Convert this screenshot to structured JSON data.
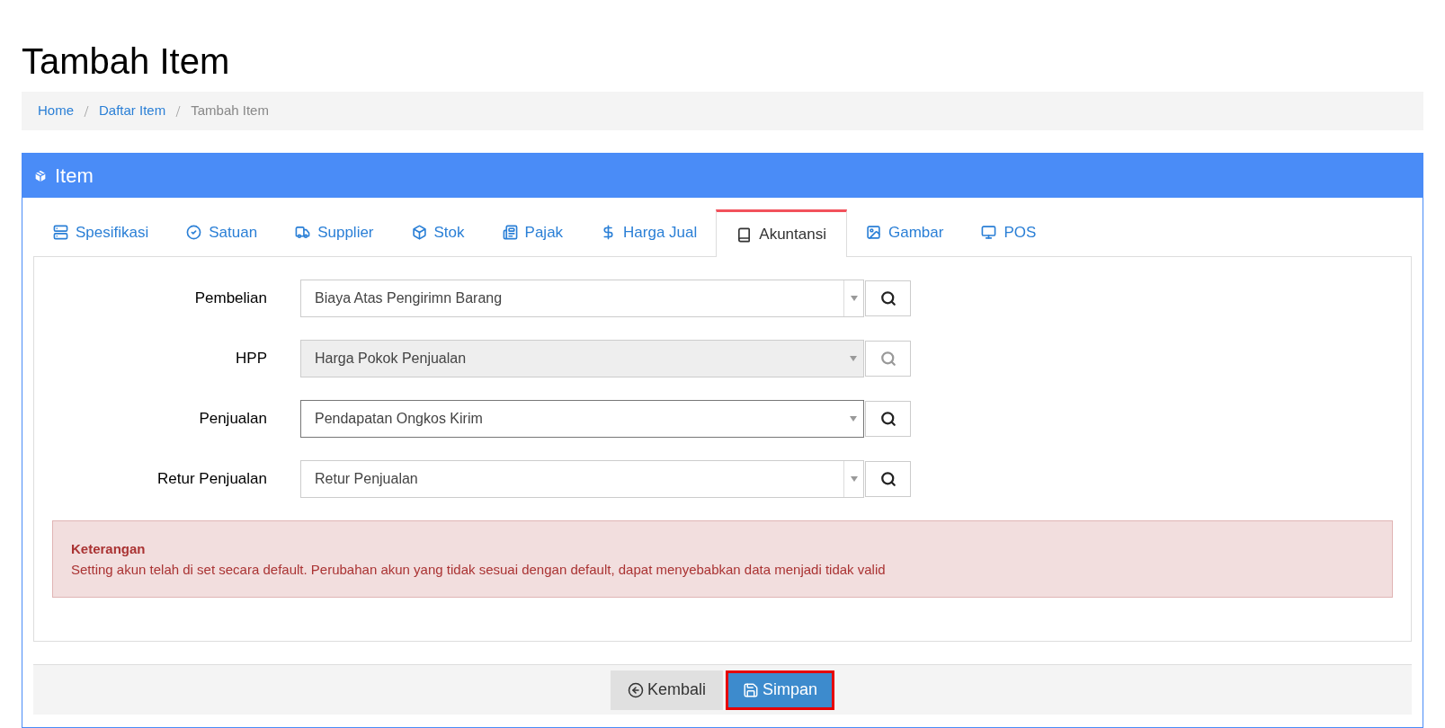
{
  "page_title": "Tambah Item",
  "breadcrumb": [
    {
      "label": "Home",
      "link": true
    },
    {
      "label": "Daftar Item",
      "link": true
    },
    {
      "label": "Tambah Item",
      "link": false
    }
  ],
  "panel": {
    "title": "Item"
  },
  "tabs": [
    {
      "label": "Spesifikasi",
      "kind": "list",
      "selected": false
    },
    {
      "label": "Satuan",
      "kind": "check",
      "selected": false
    },
    {
      "label": "Supplier",
      "kind": "truck",
      "selected": false
    },
    {
      "label": "Stok",
      "kind": "box",
      "selected": false
    },
    {
      "label": "Pajak",
      "kind": "table",
      "selected": false
    },
    {
      "label": "Harga Jual",
      "kind": "dollar",
      "selected": false
    },
    {
      "label": "Akuntansi",
      "kind": "book",
      "selected": true
    },
    {
      "label": "Gambar",
      "kind": "image",
      "selected": false
    },
    {
      "label": "POS",
      "kind": "monitor",
      "selected": false
    }
  ],
  "fields": [
    {
      "label": "Pembelian",
      "value": "Biaya Atas Pengirimn Barang",
      "disabled": false,
      "focused": false
    },
    {
      "label": "HPP",
      "value": "Harga Pokok Penjualan",
      "disabled": true,
      "focused": false
    },
    {
      "label": "Penjualan",
      "value": "Pendapatan Ongkos Kirim",
      "disabled": false,
      "focused": true
    },
    {
      "label": "Retur Penjualan",
      "value": "Retur Penjualan",
      "disabled": false,
      "focused": false
    }
  ],
  "alert": {
    "title": "Keterangan",
    "text": "Setting akun telah di set secara default. Perubahan akun yang tidak sesuai dengan default, dapat menyebabkan data menjadi tidak valid"
  },
  "buttons": [
    {
      "label": "Kembali",
      "kind": "back",
      "highlighted": false
    },
    {
      "label": "Simpan",
      "kind": "save",
      "highlighted": true
    }
  ]
}
